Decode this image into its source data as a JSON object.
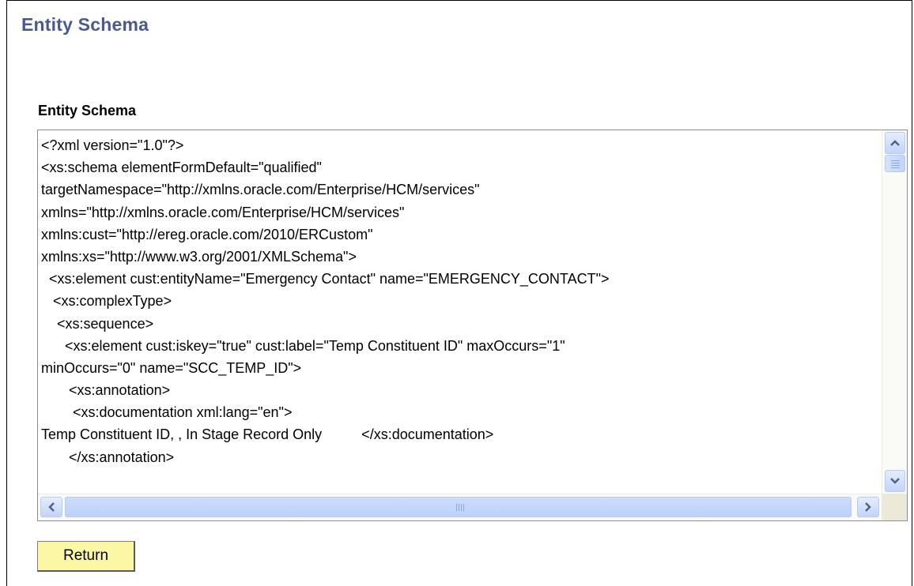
{
  "page": {
    "title": "Entity Schema"
  },
  "schema_field": {
    "label": "Entity Schema",
    "lines": [
      "<?xml version=\"1.0\"?>",
      "<xs:schema elementFormDefault=\"qualified\"",
      "targetNamespace=\"http://xmlns.oracle.com/Enterprise/HCM/services\"",
      "xmlns=\"http://xmlns.oracle.com/Enterprise/HCM/services\"",
      "xmlns:cust=\"http://ereg.oracle.com/2010/ERCustom\"",
      "xmlns:xs=\"http://www.w3.org/2001/XMLSchema\">",
      "  <xs:element cust:entityName=\"Emergency Contact\" name=\"EMERGENCY_CONTACT\">",
      "   <xs:complexType>",
      "    <xs:sequence>",
      "      <xs:element cust:iskey=\"true\" cust:label=\"Temp Constituent ID\" maxOccurs=\"1\"",
      "minOccurs=\"0\" name=\"SCC_TEMP_ID\">",
      "       <xs:annotation>",
      "        <xs:documentation xml:lang=\"en\">",
      "Temp Constituent ID, , In Stage Record Only          </xs:documentation>",
      "       </xs:annotation>"
    ]
  },
  "scrollbars": {
    "up_icon": "chevron-up-icon",
    "down_icon": "chevron-down-icon",
    "left_icon": "chevron-left-icon",
    "right_icon": "chevron-right-icon"
  },
  "actions": {
    "return_label": "Return"
  },
  "colors": {
    "title": "#4b5a8c",
    "button_bg": "#fcf7a5",
    "scrollbar_accent": "#c3d4fa"
  }
}
